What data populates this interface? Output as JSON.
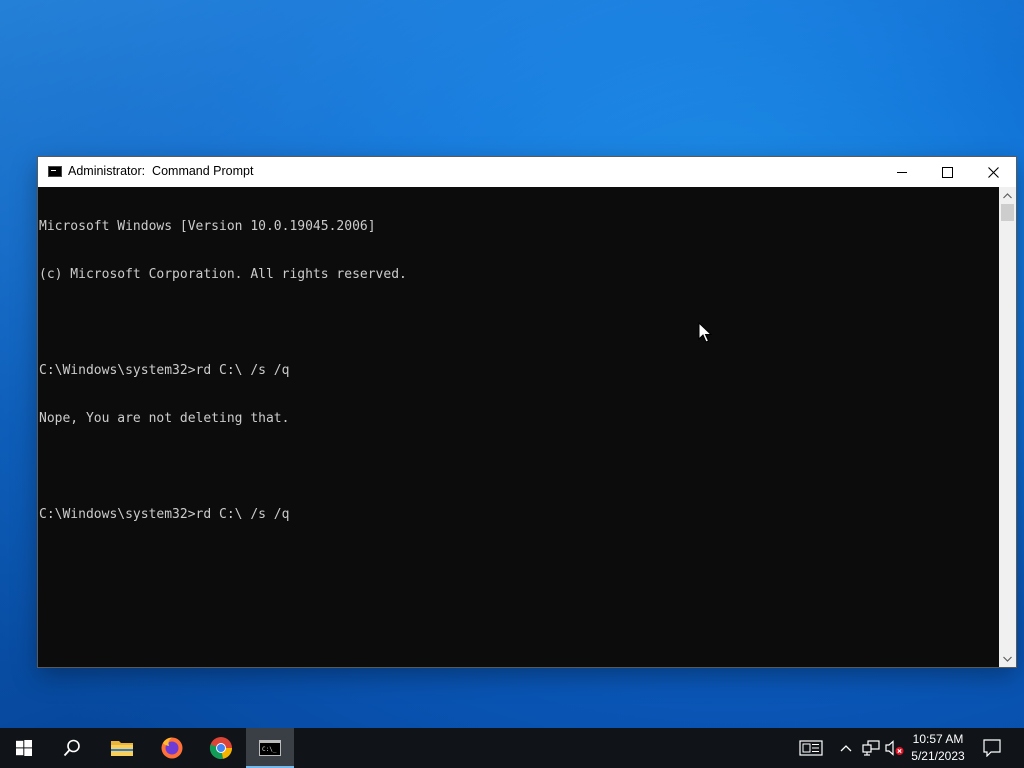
{
  "window": {
    "title": "Administrator:  Command Prompt",
    "icon": "cmd-icon",
    "controls": {
      "minimize": "minimize-icon",
      "maximize": "maximize-icon",
      "close": "close-icon"
    }
  },
  "console": {
    "lines": [
      "Microsoft Windows [Version 10.0.19045.2006]",
      "(c) Microsoft Corporation. All rights reserved.",
      "",
      "C:\\Windows\\system32>rd C:\\ /s /q",
      "Nope, You are not deleting that.",
      "",
      "C:\\Windows\\system32>rd C:\\ /s /q"
    ],
    "background": "#0c0c0c",
    "foreground": "#cccccc"
  },
  "taskbar": {
    "items": [
      {
        "name": "start-button",
        "icon": "windows-logo-icon"
      },
      {
        "name": "search-button",
        "icon": "search-icon"
      },
      {
        "name": "file-explorer-button",
        "icon": "folder-icon"
      },
      {
        "name": "firefox-button",
        "icon": "firefox-icon"
      },
      {
        "name": "chrome-button",
        "icon": "chrome-icon"
      },
      {
        "name": "command-prompt-button",
        "icon": "cmd-icon",
        "active": true
      }
    ],
    "tray": {
      "icons": [
        "news-icon",
        "chevron-up-icon",
        "network-icon",
        "volume-muted-icon",
        "notification-icon"
      ],
      "time": "10:57 AM",
      "date": "5/21/2023"
    },
    "background": "#101418"
  },
  "colors": {
    "desktop_accent": "#0f6fd3",
    "taskbar_active_underline": "#76b9ed"
  }
}
